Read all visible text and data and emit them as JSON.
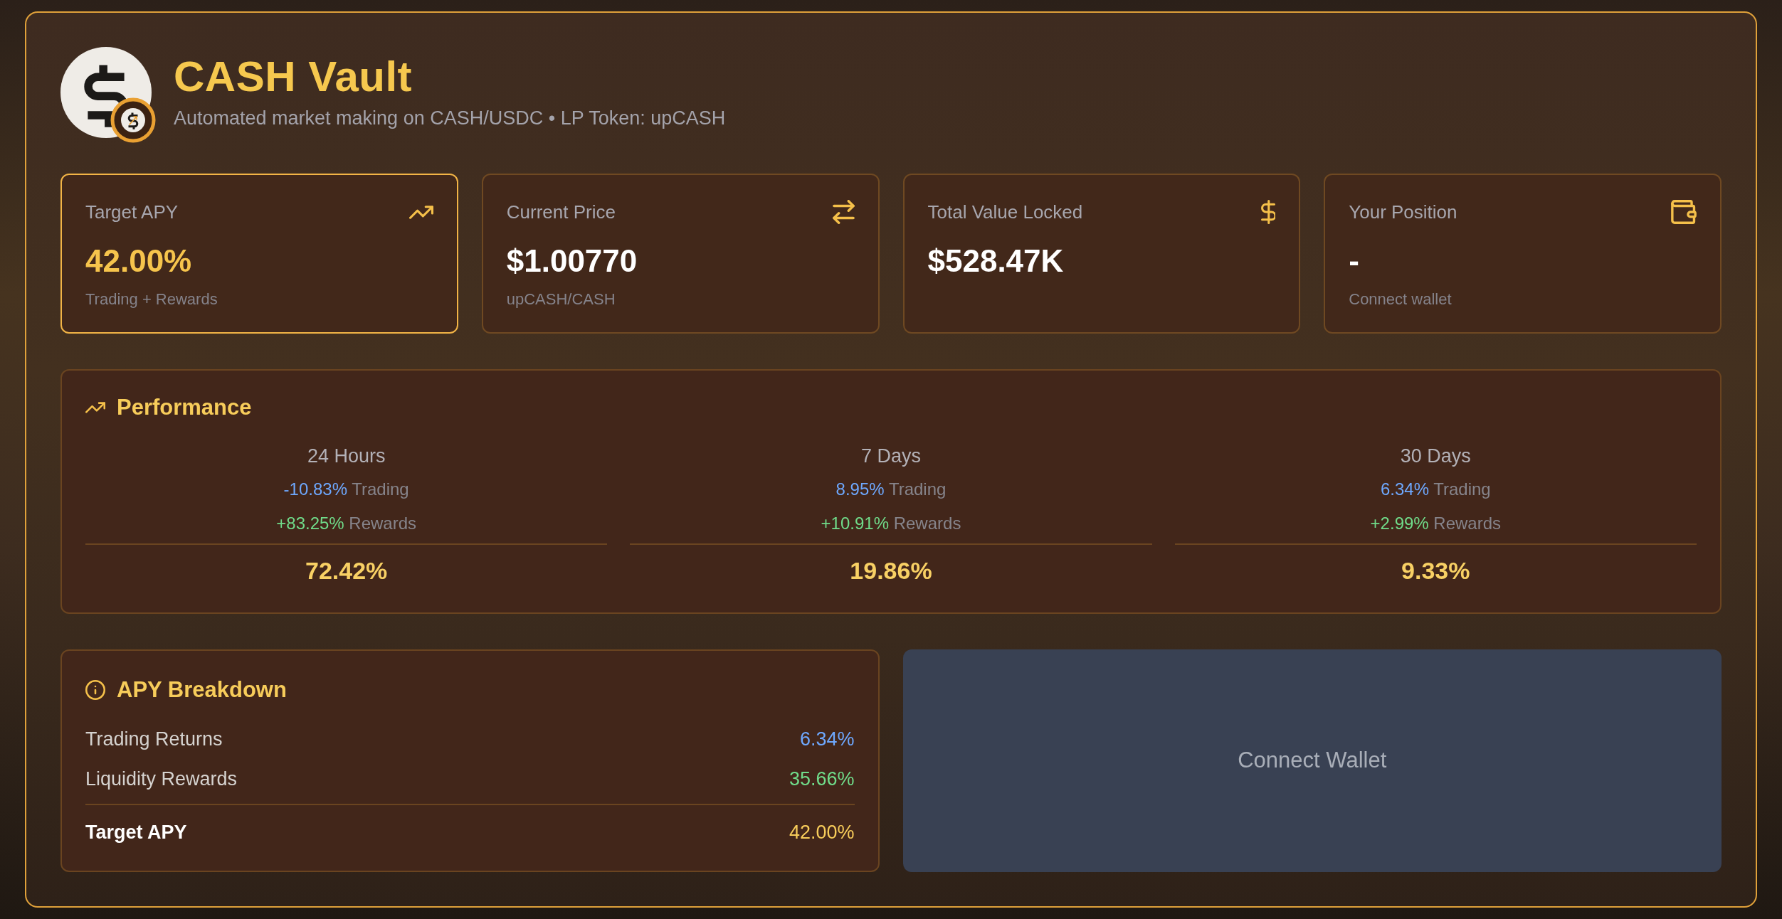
{
  "header": {
    "title": "CASH Vault",
    "subtitle": "Automated market making on CASH/USDC • LP Token: upCASH"
  },
  "stats": [
    {
      "kind": "apy",
      "label": "Target APY",
      "value": "42.00%",
      "note": "Trading + Rewards",
      "highlighted": true
    },
    {
      "kind": "price",
      "label": "Current Price",
      "value": "$1.00770",
      "note": "upCASH/CASH",
      "highlighted": false
    },
    {
      "kind": "tvl",
      "label": "Total Value Locked",
      "value": "$528.47K",
      "highlighted": false
    },
    {
      "kind": "position",
      "label": "Your Position",
      "value": "-",
      "note": "Connect wallet",
      "highlighted": false
    }
  ],
  "performance": {
    "title": "Performance",
    "periods": [
      {
        "label": "24 Hours",
        "trading": "-10.83%",
        "trading_label": "Trading",
        "rewards": "+83.25%",
        "rewards_label": "Rewards",
        "total": "72.42%"
      },
      {
        "label": "7 Days",
        "trading": "8.95%",
        "trading_label": "Trading",
        "rewards": "+10.91%",
        "rewards_label": "Rewards",
        "total": "19.86%"
      },
      {
        "label": "30 Days",
        "trading": "6.34%",
        "trading_label": "Trading",
        "rewards": "+2.99%",
        "rewards_label": "Rewards",
        "total": "9.33%"
      }
    ]
  },
  "apy_breakdown": {
    "title": "APY Breakdown",
    "rows": [
      {
        "kind": "trading",
        "label": "Trading Returns",
        "value": "6.34%"
      },
      {
        "kind": "rewards",
        "label": "Liquidity Rewards",
        "value": "35.66%"
      },
      {
        "kind": "total",
        "label": "Target APY",
        "value": "42.00%"
      }
    ]
  },
  "connect_button": {
    "label": "Connect Wallet"
  }
}
